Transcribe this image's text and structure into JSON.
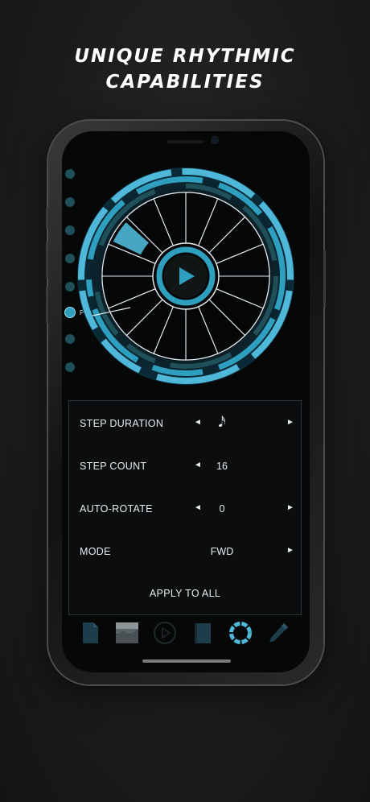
{
  "headline": {
    "line1": "UNIQUE RHYTHMIC",
    "line2": "CAPABILITIES"
  },
  "tracks": [
    {
      "label": "",
      "active": false
    },
    {
      "label": "",
      "active": false
    },
    {
      "label": "",
      "active": false
    },
    {
      "label": "",
      "active": false
    },
    {
      "label": "",
      "active": false
    },
    {
      "label": "Perc",
      "active": true
    },
    {
      "label": "",
      "active": false
    },
    {
      "label": "",
      "active": false
    }
  ],
  "sequencer": {
    "steps": 16,
    "play_icon": "play-icon"
  },
  "settings": {
    "step_duration": {
      "label": "STEP DURATION",
      "value": "𝅘𝅥𝅯"
    },
    "step_count": {
      "label": "STEP COUNT",
      "value": "16"
    },
    "auto_rotate": {
      "label": "AUTO-ROTATE",
      "value": "0"
    },
    "mode": {
      "label": "MODE",
      "value": "FWD"
    },
    "apply_label": "APPLY TO ALL",
    "arrow_left": "◄",
    "arrow_right": "►"
  },
  "toolbar": {
    "items": [
      "document-icon",
      "thumbnail-image",
      "play-circle-icon",
      "book-icon",
      "sequencer-ring-icon",
      "pencil-icon"
    ],
    "active": "sequencer-ring-icon"
  },
  "colors": {
    "accent": "#2e9fbf",
    "accent_light": "#4fb8d8",
    "accent_dark": "#1f4f59"
  }
}
